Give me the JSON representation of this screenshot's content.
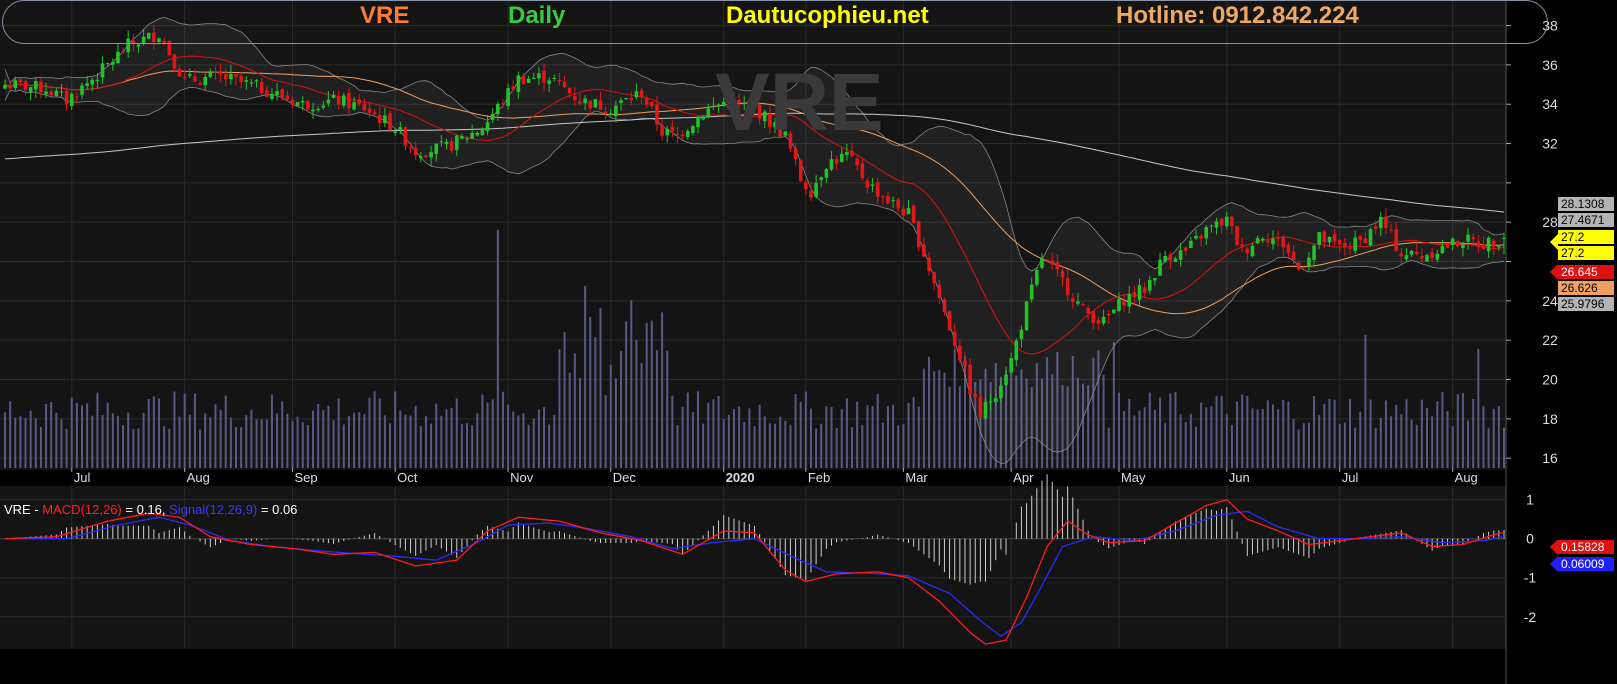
{
  "header": {
    "ticker": "VRE",
    "timeframe": "Daily",
    "site": "Dautucophieu.net",
    "hotline": "Hotline: 0912.842.224"
  },
  "watermark": "VRE",
  "colors": {
    "background": "#000000",
    "plot_bg": "#141414",
    "grid": "#2b2b2b",
    "up_candle": "#22c22a",
    "down_candle": "#e01818",
    "volume": "#585a86",
    "ticker": "#ff7a33",
    "timeframe": "#3ec83e",
    "site": "#ffff00",
    "hotline": "#f0a860",
    "macd": "#ff1c1c",
    "signal": "#2a2aff"
  },
  "chart_data": [
    {
      "type": "candlestick",
      "ylim": [
        15.5,
        39.3
      ],
      "y_ticks": [
        16,
        18,
        20,
        22,
        24,
        26,
        28,
        30,
        32,
        34,
        36,
        38
      ],
      "y_tick_labels": [
        "16",
        "18",
        "20",
        "22",
        "24",
        "",
        "28",
        "",
        "32",
        "34",
        "36",
        "38"
      ],
      "x_tick_labels": [
        "Jul",
        "Aug",
        "Sep",
        "Oct",
        "Nov",
        "Dec",
        "2020",
        "Feb",
        "Mar",
        "Apr",
        "May",
        "Jun",
        "Jul",
        "Aug"
      ],
      "x_tick_session": [
        13,
        35,
        56,
        76,
        98,
        118,
        140,
        156,
        175,
        196,
        217,
        238,
        260,
        282
      ],
      "close_anchors": [
        [
          0,
          35.0
        ],
        [
          8,
          34.8
        ],
        [
          12,
          34.2
        ],
        [
          18,
          35.5
        ],
        [
          24,
          37.0
        ],
        [
          30,
          37.6
        ],
        [
          35,
          35.2
        ],
        [
          42,
          35.4
        ],
        [
          50,
          34.8
        ],
        [
          58,
          34.0
        ],
        [
          65,
          34.2
        ],
        [
          70,
          33.8
        ],
        [
          76,
          32.8
        ],
        [
          80,
          31.6
        ],
        [
          86,
          31.8
        ],
        [
          93,
          32.8
        ],
        [
          97,
          34.2
        ],
        [
          100,
          35.3
        ],
        [
          106,
          35.4
        ],
        [
          112,
          34.2
        ],
        [
          118,
          33.8
        ],
        [
          124,
          34.6
        ],
        [
          128,
          32.6
        ],
        [
          131,
          32.4
        ],
        [
          136,
          33.6
        ],
        [
          140,
          34.1
        ],
        [
          146,
          33.8
        ],
        [
          152,
          32.4
        ],
        [
          155,
          30.2
        ],
        [
          157,
          29.6
        ],
        [
          160,
          31.0
        ],
        [
          164,
          31.4
        ],
        [
          168,
          30.0
        ],
        [
          172,
          29.1
        ],
        [
          176,
          28.4
        ],
        [
          179,
          26.4
        ],
        [
          183,
          23.4
        ],
        [
          186,
          21.2
        ],
        [
          188,
          19.5
        ],
        [
          190,
          18.2
        ],
        [
          193,
          19.4
        ],
        [
          196,
          21.0
        ],
        [
          199,
          23.7
        ],
        [
          202,
          26.2
        ],
        [
          206,
          25.0
        ],
        [
          210,
          23.5
        ],
        [
          214,
          22.9
        ],
        [
          218,
          24.1
        ],
        [
          222,
          24.6
        ],
        [
          226,
          26.3
        ],
        [
          230,
          26.5
        ],
        [
          234,
          27.6
        ],
        [
          238,
          28.1
        ],
        [
          241,
          26.5
        ],
        [
          245,
          27.4
        ],
        [
          249,
          26.9
        ],
        [
          252,
          25.6
        ],
        [
          256,
          27.2
        ],
        [
          260,
          26.7
        ],
        [
          264,
          27.0
        ],
        [
          268,
          28.1
        ],
        [
          272,
          26.4
        ],
        [
          276,
          26.3
        ],
        [
          280,
          26.7
        ],
        [
          284,
          27.1
        ],
        [
          288,
          26.9
        ],
        [
          292,
          27.2
        ]
      ],
      "overlays": [
        "Bollinger Bands (20,2)",
        "MA20",
        "MA50",
        "MA200",
        "Volume"
      ],
      "last_values": {
        "bb_upper": "28.1308",
        "bb_mid": "27.4671",
        "close": "27.2",
        "open": "27.2",
        "ma_red": "26.645",
        "ma_orange": "26.626",
        "bb_lower": "25.9796"
      },
      "volume_spikes": [
        [
          96,
          3.4
        ],
        [
          113,
          2.6
        ],
        [
          122,
          2.4
        ],
        [
          208,
          1.6
        ],
        [
          216,
          1.8
        ],
        [
          265,
          1.9
        ],
        [
          287,
          1.7
        ]
      ]
    },
    {
      "type": "line",
      "title": "MACD",
      "legend_parts": {
        "symbol": "VRE",
        "sep": " - ",
        "macd_label": "MACD(12,26)",
        "macd_eq": " = 0.16, ",
        "signal_label": "Signal(12,26,9)",
        "signal_eq": " = 0.06"
      },
      "ylim": [
        -2.8,
        1.35
      ],
      "y_ticks": [
        1,
        0,
        -1,
        -2
      ],
      "y_tick_labels": [
        "1",
        "0",
        "-1",
        "-2"
      ],
      "last_values": {
        "macd": "0.15828",
        "signal": "0.06009"
      },
      "series": [
        {
          "name": "MACD(12,26)",
          "anchors": [
            [
              0,
              0.0
            ],
            [
              10,
              0.05
            ],
            [
              20,
              0.45
            ],
            [
              28,
              0.65
            ],
            [
              34,
              0.55
            ],
            [
              40,
              0.05
            ],
            [
              48,
              -0.15
            ],
            [
              56,
              -0.25
            ],
            [
              64,
              -0.4
            ],
            [
              72,
              -0.35
            ],
            [
              80,
              -0.7
            ],
            [
              88,
              -0.55
            ],
            [
              94,
              0.2
            ],
            [
              100,
              0.55
            ],
            [
              108,
              0.45
            ],
            [
              116,
              0.15
            ],
            [
              124,
              -0.05
            ],
            [
              132,
              -0.4
            ],
            [
              140,
              0.2
            ],
            [
              146,
              0.15
            ],
            [
              152,
              -0.8
            ],
            [
              156,
              -1.1
            ],
            [
              162,
              -0.9
            ],
            [
              170,
              -0.85
            ],
            [
              176,
              -1.0
            ],
            [
              182,
              -1.6
            ],
            [
              188,
              -2.4
            ],
            [
              191,
              -2.7
            ],
            [
              195,
              -2.6
            ],
            [
              199,
              -1.5
            ],
            [
              203,
              -0.2
            ],
            [
              207,
              0.45
            ],
            [
              211,
              0.1
            ],
            [
              215,
              -0.1
            ],
            [
              222,
              -0.05
            ],
            [
              228,
              0.4
            ],
            [
              234,
              0.85
            ],
            [
              238,
              1.0
            ],
            [
              242,
              0.5
            ],
            [
              248,
              0.2
            ],
            [
              254,
              -0.15
            ],
            [
              260,
              -0.05
            ],
            [
              266,
              0.05
            ],
            [
              272,
              0.15
            ],
            [
              278,
              -0.2
            ],
            [
              284,
              -0.15
            ],
            [
              290,
              0.1
            ],
            [
              292,
              0.16
            ]
          ]
        },
        {
          "name": "Signal(12,26,9)",
          "anchors": [
            [
              0,
              0.0
            ],
            [
              12,
              0.0
            ],
            [
              22,
              0.35
            ],
            [
              30,
              0.55
            ],
            [
              36,
              0.35
            ],
            [
              44,
              -0.05
            ],
            [
              52,
              -0.2
            ],
            [
              60,
              -0.3
            ],
            [
              68,
              -0.38
            ],
            [
              76,
              -0.45
            ],
            [
              84,
              -0.55
            ],
            [
              92,
              -0.1
            ],
            [
              98,
              0.35
            ],
            [
              106,
              0.4
            ],
            [
              114,
              0.25
            ],
            [
              122,
              0.05
            ],
            [
              130,
              -0.25
            ],
            [
              138,
              -0.1
            ],
            [
              146,
              0.0
            ],
            [
              154,
              -0.5
            ],
            [
              160,
              -0.85
            ],
            [
              168,
              -0.88
            ],
            [
              176,
              -0.95
            ],
            [
              184,
              -1.4
            ],
            [
              190,
              -2.1
            ],
            [
              194,
              -2.5
            ],
            [
              198,
              -2.15
            ],
            [
              202,
              -1.2
            ],
            [
              206,
              -0.2
            ],
            [
              212,
              0.05
            ],
            [
              220,
              -0.05
            ],
            [
              228,
              0.2
            ],
            [
              236,
              0.6
            ],
            [
              242,
              0.7
            ],
            [
              248,
              0.3
            ],
            [
              256,
              0.0
            ],
            [
              264,
              0.0
            ],
            [
              272,
              0.05
            ],
            [
              280,
              -0.1
            ],
            [
              288,
              -0.05
            ],
            [
              292,
              0.06
            ]
          ]
        }
      ]
    }
  ]
}
